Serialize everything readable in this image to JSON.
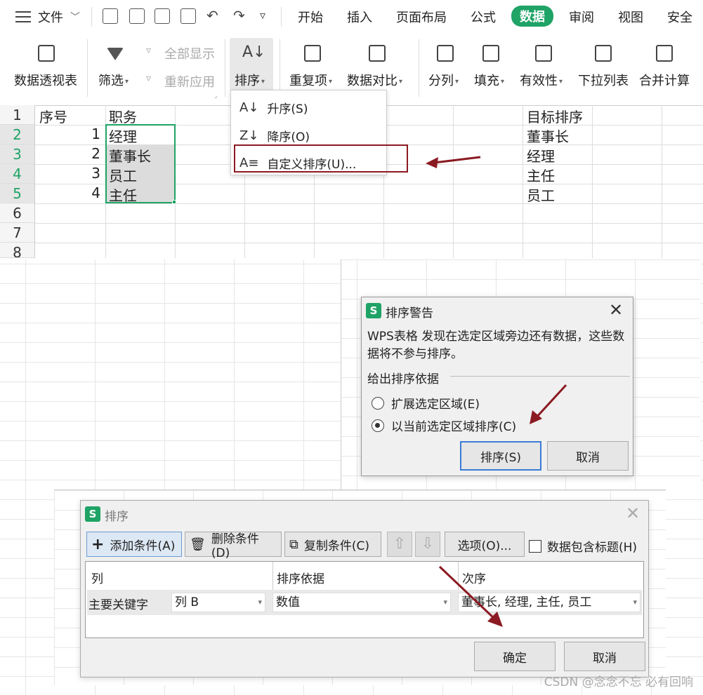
{
  "menubar": {
    "file_label": "文件",
    "tabs": [
      "开始",
      "插入",
      "页面布局",
      "公式",
      "数据",
      "审阅",
      "视图",
      "安全"
    ],
    "active_tab": "数据"
  },
  "ribbon": {
    "pivot": "数据透视表",
    "filter": "筛选",
    "show_all": "全部显示",
    "reapply": "重新应用",
    "sort": "排序",
    "duplicates": "重复项",
    "compare": "数据对比",
    "split": "分列",
    "fill": "填充",
    "validity": "有效性",
    "dropdown_list": "下拉列表",
    "consolidate": "合并计算"
  },
  "sort_menu": {
    "ascending": "升序(S)",
    "descending": "降序(O)",
    "custom": "自定义排序(U)..."
  },
  "sheet": {
    "row_numbers": [
      "1",
      "2",
      "3",
      "4",
      "5",
      "6",
      "7",
      "8"
    ],
    "header_a": "序号",
    "header_b": "职务",
    "header_target": "目标排序",
    "rows": [
      {
        "num": "1",
        "title": "经理"
      },
      {
        "num": "2",
        "title": "董事长"
      },
      {
        "num": "3",
        "title": "员工"
      },
      {
        "num": "4",
        "title": "主任"
      }
    ],
    "target": [
      "董事长",
      "经理",
      "主任",
      "员工"
    ]
  },
  "warning_dialog": {
    "title": "排序警告",
    "message": "WPS表格 发现在选定区域旁边还有数据，这些数据将不参与排序。",
    "group_label": "给出排序依据",
    "option_expand": "扩展选定区域(E)",
    "option_current": "以当前选定区域排序(C)",
    "sort_button": "排序(S)",
    "cancel_button": "取消"
  },
  "sort_dialog": {
    "title": "排序",
    "add_condition": "添加条件(A)",
    "delete_condition": "删除条件(D)",
    "copy_condition": "复制条件(C)",
    "options": "选项(O)...",
    "has_header": "数据包含标题(H)",
    "col_header": "列",
    "basis_header": "排序依据",
    "order_header": "次序",
    "row_label": "主要关键字",
    "column_value": "列 B",
    "basis_value": "数值",
    "order_value": "董事长, 经理, 主任, 员工",
    "ok_button": "确定",
    "cancel_button": "取消"
  },
  "watermark": "CSDN @念念不忘 必有回响",
  "colors": {
    "accent": "#1fa366",
    "annotation": "#8b1a22"
  }
}
